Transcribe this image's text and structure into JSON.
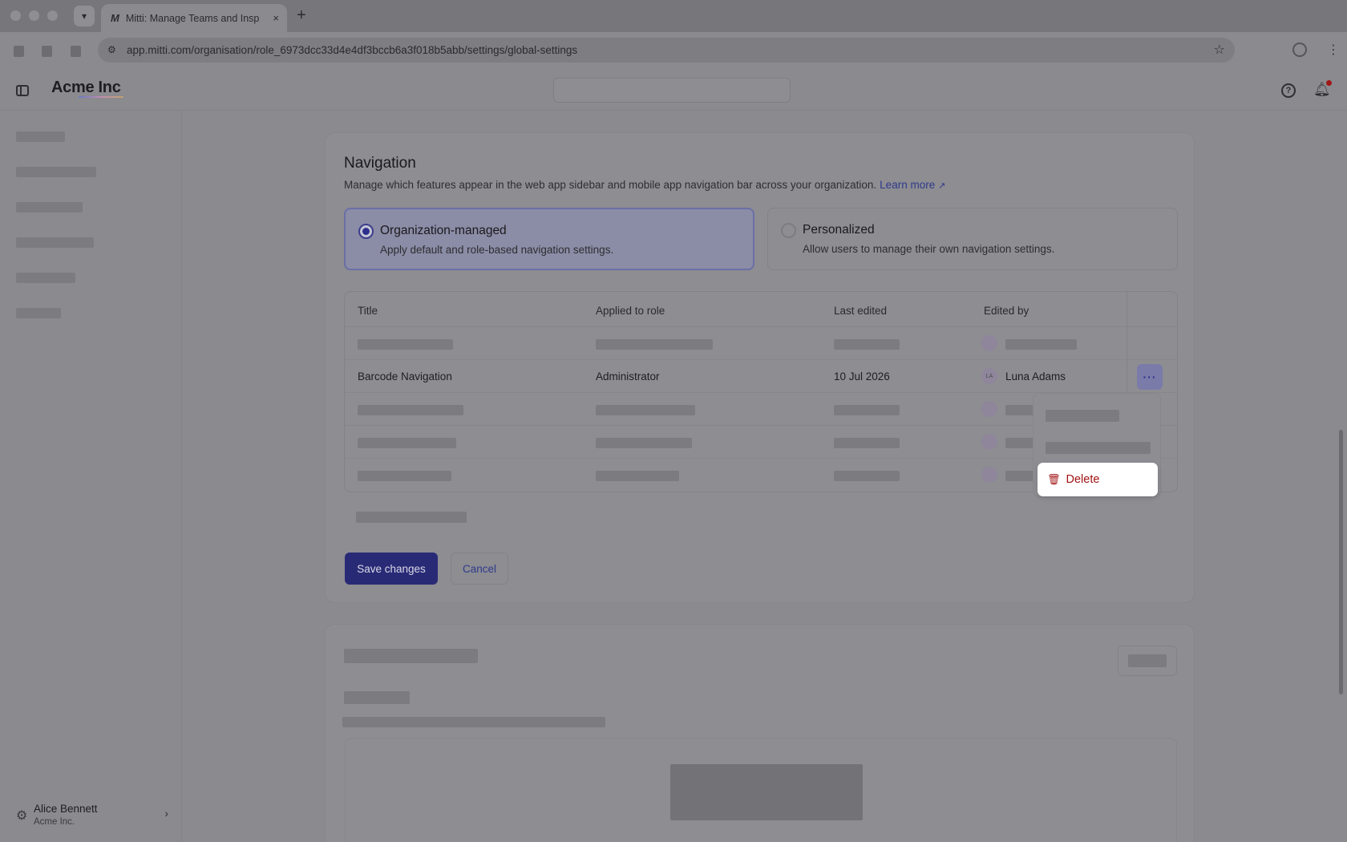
{
  "browser": {
    "tab_favicon": "M",
    "tab_title": "Mitti: Manage Teams and Insp",
    "tab_close": "×",
    "new_tab": "+",
    "url": "app.mitti.com/organisation/role_6973dcc33d4e4df3bccb6a3f018b5abb/settings/global-settings"
  },
  "header": {
    "brand": "Acme Inc"
  },
  "sidebar": {
    "user_name": "Alice Bennett",
    "user_org": "Acme Inc."
  },
  "navigation": {
    "title": "Navigation",
    "description": "Manage which features appear in the web app sidebar and mobile app navigation bar across your organization.",
    "learn_more": "Learn more",
    "options": {
      "org_label": "Organization-managed",
      "org_desc": "Apply default and role-based navigation settings.",
      "per_label": "Personalized",
      "per_desc": "Allow users to manage their own navigation settings.",
      "selected": "Organization-managed"
    },
    "table": {
      "headers": {
        "title": "Title",
        "role": "Applied to role",
        "edited": "Last edited",
        "by": "Edited by"
      },
      "row": {
        "title": "Barcode Navigation",
        "role": "Administrator",
        "edited": "10 Jul 2026",
        "avatar": "LA",
        "by": "Luna Adams",
        "more": "···"
      }
    },
    "save_label": "Save changes",
    "cancel_label": "Cancel"
  },
  "menu": {
    "delete_label": "Delete"
  },
  "icons": {
    "brand_gradient": [
      "#6b7ac0",
      "#c08bb2",
      "#c0a26b"
    ],
    "danger": "#a31313",
    "accent": "#292a76"
  }
}
